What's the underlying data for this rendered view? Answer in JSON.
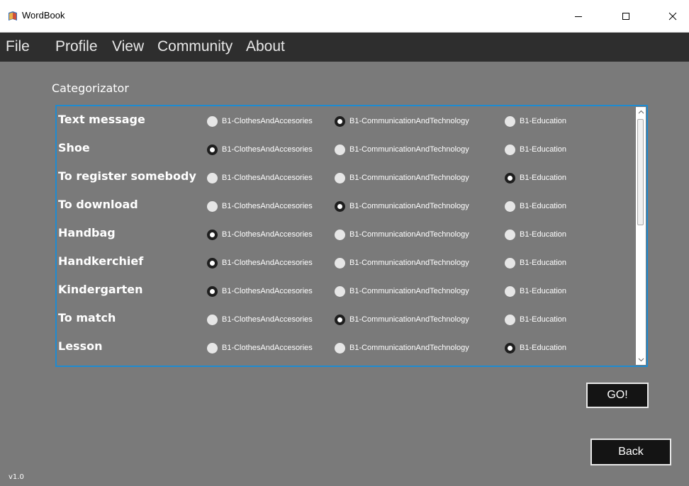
{
  "window": {
    "title": "WordBook",
    "app_icon": "book-icon",
    "controls": [
      "minimize-icon",
      "maximize-icon",
      "close-icon"
    ]
  },
  "menu": {
    "items": [
      "File",
      "Profile",
      "View",
      "Community",
      "About"
    ]
  },
  "section": {
    "title": "Categorizator"
  },
  "options": [
    "B1-ClothesAndAccesories",
    "B1-CommunicationAndTechnology",
    "B1-Education"
  ],
  "words": [
    {
      "text": "Text message",
      "selected": 1
    },
    {
      "text": "Shoe",
      "selected": 0
    },
    {
      "text": "To register somebody",
      "selected": 2
    },
    {
      "text": "To download",
      "selected": 1
    },
    {
      "text": "Handbag",
      "selected": 0
    },
    {
      "text": "Handkerchief",
      "selected": 0
    },
    {
      "text": "Kindergarten",
      "selected": 0
    },
    {
      "text": "To match",
      "selected": 1
    },
    {
      "text": "Lesson",
      "selected": 2
    }
  ],
  "buttons": {
    "go": "GO!",
    "back": "Back"
  },
  "version": "v1.0",
  "colors": {
    "accent_border": "#1f8bd0",
    "background": "#7a7a7a",
    "menubar": "#2e2e2e"
  }
}
